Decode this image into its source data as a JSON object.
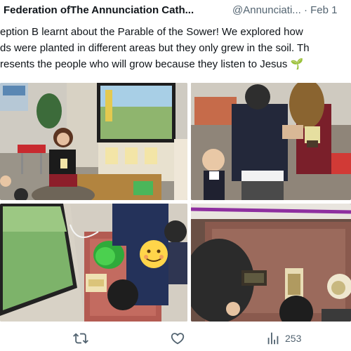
{
  "tweet": {
    "author_name": "Federation ofThe Annunciation Cath...",
    "handle": "@Annunciati...",
    "separator": "·",
    "date": "Feb 1",
    "text_lines": [
      "eption B learnt about the Parable of the Sower! We explored how",
      "ds were planted in different areas but they only grew in the soil. Th",
      "resents the people who will grow because they listen to Jesus"
    ],
    "emoji": "🌱"
  },
  "media": {
    "photos": [
      {
        "name": "classroom-teacher-photo"
      },
      {
        "name": "children-planting-photo"
      },
      {
        "name": "children-at-tray-photo"
      },
      {
        "name": "seed-pots-photo"
      }
    ]
  },
  "actions": {
    "retweet_icon": "retweet-icon",
    "like_icon": "heart-icon",
    "views_icon": "views-icon",
    "views_count": "253"
  },
  "colors": {
    "text": "#0f1419",
    "secondary": "#536471",
    "plant": "#4caf50"
  }
}
